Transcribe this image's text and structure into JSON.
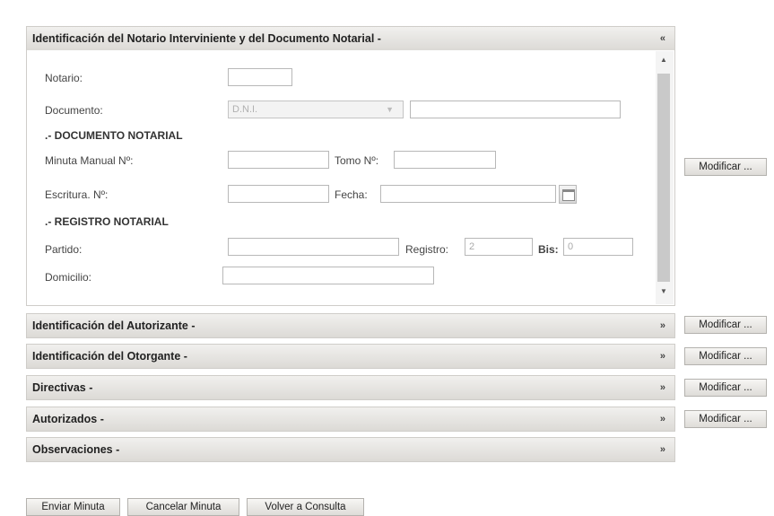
{
  "panels": {
    "notario": {
      "title": "Identificación del Notario Interviniente y del Documento Notarial -",
      "chevron": "«",
      "fields": {
        "notario_label": "Notario:",
        "documento_label": "Documento:",
        "documento_select": "D.N.I.",
        "documento_section": ".- DOCUMENTO NOTARIAL",
        "minuta_label": "Minuta Manual Nº:",
        "tomo_label": "Tomo Nº:",
        "escritura_label": "Escritura. Nº:",
        "fecha_label": "Fecha:",
        "registro_section": ".- REGISTRO NOTARIAL",
        "partido_label": "Partido:",
        "registro_label": "Registro:",
        "registro_value": "2",
        "bis_label": "Bis:",
        "bis_value": "0",
        "domicilio_label": "Domicilio:"
      },
      "modify_label": "Modificar ..."
    },
    "autorizante": {
      "title": "Identificación del Autorizante -",
      "chevron": "»",
      "modify_label": "Modificar ..."
    },
    "otorgante": {
      "title": "Identificación del Otorgante -",
      "chevron": "»",
      "modify_label": "Modificar ..."
    },
    "directivas": {
      "title": "Directivas -",
      "chevron": "»",
      "modify_label": "Modificar ..."
    },
    "autorizados": {
      "title": "Autorizados -",
      "chevron": "»",
      "modify_label": "Modificar ..."
    },
    "observaciones": {
      "title": "Observaciones -",
      "chevron": "»"
    }
  },
  "footer": {
    "enviar": "Enviar Minuta",
    "cancelar": "Cancelar Minuta",
    "volver": "Volver a Consulta"
  },
  "icons": {
    "calendar": "calendar-icon",
    "scroll_up": "scroll-up-arrow-icon",
    "scroll_down": "scroll-down-arrow-icon",
    "select_arrow": "chevron-down-icon"
  }
}
